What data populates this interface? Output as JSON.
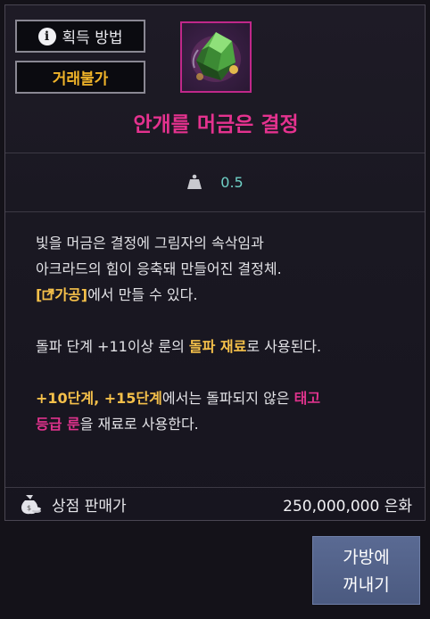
{
  "header": {
    "acquire_label": "획득 방법",
    "trade_label": "거래불가"
  },
  "item": {
    "name": "안개를 머금은 결정",
    "weight": "0.5"
  },
  "description": {
    "line1": "빛을 머금은 결정에 그림자의 속삭임과",
    "line2": "아크라드의 힘이 응축돼 만들어진 결정체.",
    "link_text": "가공",
    "line3_rest": "에서 만들 수 있다.",
    "line4_a": "돌파 단계 +11이상 룬의 ",
    "line4_highlight": "돌파 재료",
    "line4_b": "로 사용된다.",
    "line5_highlight": "+10단계, +15단계",
    "line5_b": "에서는 돌파되지 않은 ",
    "line5_pink": "태고",
    "line6_pink": "등급 룬",
    "line6_b": "을 재료로 사용한다."
  },
  "price": {
    "label": "상점 판매가",
    "value": "250,000,000 은화"
  },
  "actions": {
    "take_out_line1": "가방에",
    "take_out_line2": "꺼내기"
  },
  "colors": {
    "item_name": "#e5328f",
    "highlight_yellow": "#f5c04a",
    "weight_value": "#6fd0c6",
    "button_bg": "#4b5a80"
  },
  "icons": {
    "info": "info-circle-icon",
    "weight": "weight-icon",
    "crystal": "crystal-item-icon",
    "link": "external-link-icon",
    "money_bag": "money-bag-icon"
  }
}
